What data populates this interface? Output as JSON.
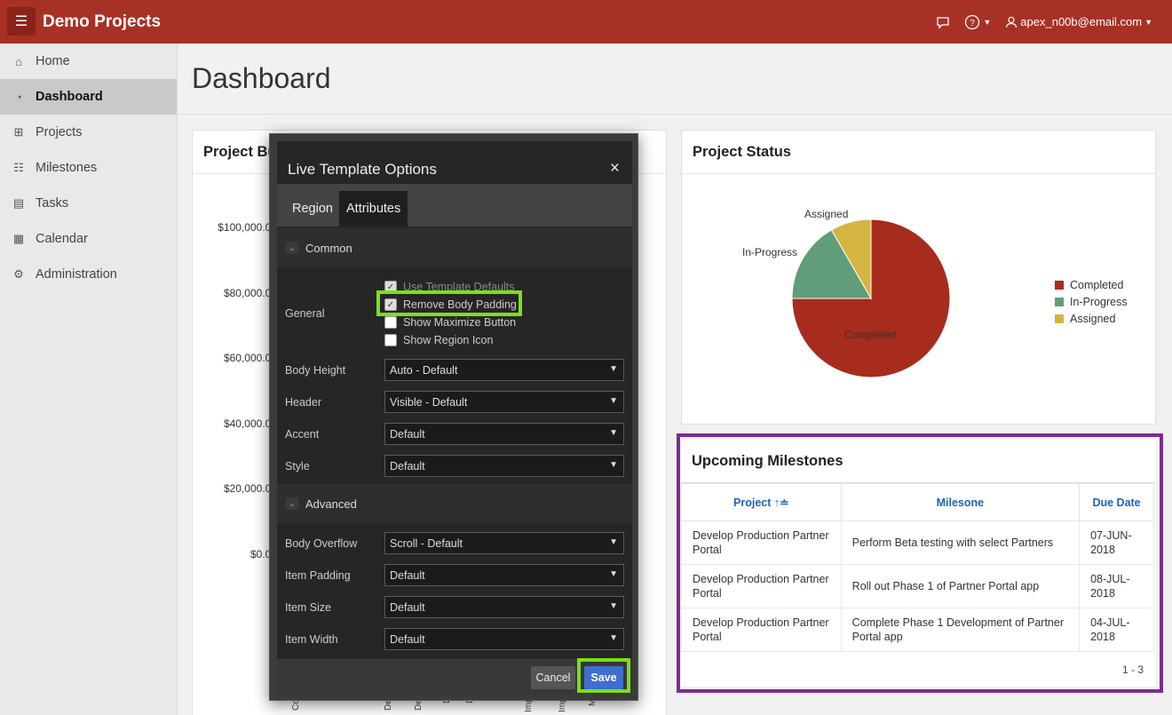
{
  "app": {
    "title": "Demo Projects",
    "user": "apex_n00b@email.com"
  },
  "sidebar": {
    "items": [
      {
        "label": "Home",
        "icon": "home-icon"
      },
      {
        "label": "Dashboard",
        "icon": "dashboard-icon"
      },
      {
        "label": "Projects",
        "icon": "projects-icon"
      },
      {
        "label": "Milestones",
        "icon": "milestones-icon"
      },
      {
        "label": "Tasks",
        "icon": "tasks-icon"
      },
      {
        "label": "Calendar",
        "icon": "calendar-icon"
      },
      {
        "label": "Administration",
        "icon": "administration-icon"
      }
    ]
  },
  "page": {
    "title": "Dashboard"
  },
  "budget": {
    "title_visible": "Project Bu",
    "y_ticks": [
      "$100,000.00",
      "$80,000.00",
      "$60,000.00",
      "$40,000.00",
      "$20,000.00",
      "$0.00"
    ],
    "x_fragments": [
      "Co",
      "I",
      "Dev",
      "Dev",
      "D",
      "D",
      "Imp",
      "Imp",
      "Mi"
    ]
  },
  "status": {
    "title": "Project Status",
    "labels": {
      "completed": "Completed",
      "in_progress": "In-Progress",
      "assigned": "Assigned"
    },
    "legend": [
      "Completed",
      "In-Progress",
      "Assigned"
    ],
    "colors": {
      "completed": "#a72c1d",
      "in_progress": "#5f9e78",
      "assigned": "#d4b541"
    }
  },
  "chart_data": {
    "type": "pie",
    "title": "Project Status",
    "categories": [
      "Completed",
      "In-Progress",
      "Assigned"
    ],
    "values": [
      0.75,
      0.1667,
      0.0833
    ],
    "legend_position": "right"
  },
  "milestones": {
    "title": "Upcoming Milestones",
    "headers": {
      "project": "Project",
      "milestone": "Milesone",
      "due": "Due Date"
    },
    "rows": [
      {
        "project": "Develop Production Partner Portal",
        "milestone": "Perform Beta testing with select Partners",
        "due": "07-JUN-2018"
      },
      {
        "project": "Develop Production Partner Portal",
        "milestone": "Roll out Phase 1 of Partner Portal app",
        "due": "08-JUL-2018"
      },
      {
        "project": "Develop Production Partner Portal",
        "milestone": "Complete Phase 1 Development of Partner Portal app",
        "due": "04-JUL-2018"
      }
    ],
    "pager": "1 - 3"
  },
  "dialog": {
    "title": "Live Template Options",
    "close": "×",
    "tabs": {
      "region": "Region",
      "attributes": "Attributes"
    },
    "sections": {
      "common": "Common",
      "advanced": "Advanced"
    },
    "general_label": "General",
    "checkboxes": {
      "use_defaults": "Use Template Defaults",
      "remove_padding": "Remove Body Padding",
      "show_max": "Show Maximize Button",
      "show_icon": "Show Region Icon"
    },
    "fields": {
      "body_height": {
        "label": "Body Height",
        "value": "Auto - Default"
      },
      "header": {
        "label": "Header",
        "value": "Visible - Default"
      },
      "accent": {
        "label": "Accent",
        "value": "Default"
      },
      "style": {
        "label": "Style",
        "value": "Default"
      },
      "body_overflow": {
        "label": "Body Overflow",
        "value": "Scroll - Default"
      },
      "item_padding": {
        "label": "Item Padding",
        "value": "Default"
      },
      "item_size": {
        "label": "Item Size",
        "value": "Default"
      },
      "item_width": {
        "label": "Item Width",
        "value": "Default"
      }
    },
    "buttons": {
      "cancel": "Cancel",
      "save": "Save"
    }
  }
}
